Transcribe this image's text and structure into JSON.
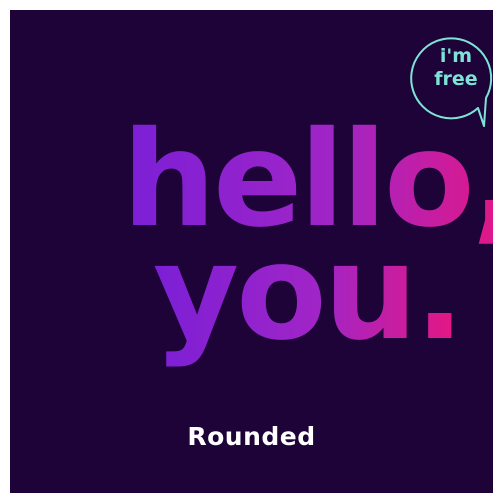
{
  "headline": {
    "line1": "hello,",
    "line2": "you."
  },
  "badge": {
    "line1": "i'm",
    "line2": "free"
  },
  "caption": "Rounded",
  "colors": {
    "background": "#1d0338",
    "gradient_start": "#7b1fd6",
    "gradient_mid": "#a225c6",
    "gradient_end": "#e8167f",
    "badge_text": "#7ee3d6",
    "badge_outline": "#7ee3d6",
    "caption": "#ffffff"
  }
}
